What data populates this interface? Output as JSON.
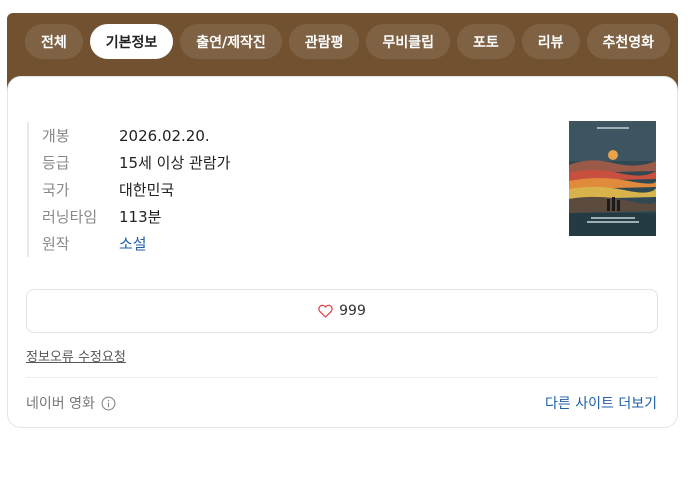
{
  "tabs": [
    {
      "label": "전체"
    },
    {
      "label": "기본정보"
    },
    {
      "label": "출연/제작진"
    },
    {
      "label": "관람평"
    },
    {
      "label": "무비클립"
    },
    {
      "label": "포토"
    },
    {
      "label": "리뷰"
    },
    {
      "label": "추천영화"
    }
  ],
  "active_tab": "기본정보",
  "info": [
    {
      "key": "개봉",
      "value": "2026.02.20."
    },
    {
      "key": "등급",
      "value": "15세 이상 관람가"
    },
    {
      "key": "국가",
      "value": "대한민국"
    },
    {
      "key": "러닝타임",
      "value": "113분"
    },
    {
      "key": "원작",
      "value": "소설"
    }
  ],
  "poster": {
    "icon": "movie-poster-image"
  },
  "like": {
    "icon": "heart-icon",
    "count": "999"
  },
  "error_report_label": "정보오류 수정요청",
  "source": {
    "label": "네이버 영화",
    "icon": "info-circle-icon"
  },
  "more_sites_label": "다른 사이트 더보기",
  "colors": {
    "header_brown": "#71512f",
    "link_blue": "#1f5fa8",
    "heart_red": "#e0474c"
  }
}
